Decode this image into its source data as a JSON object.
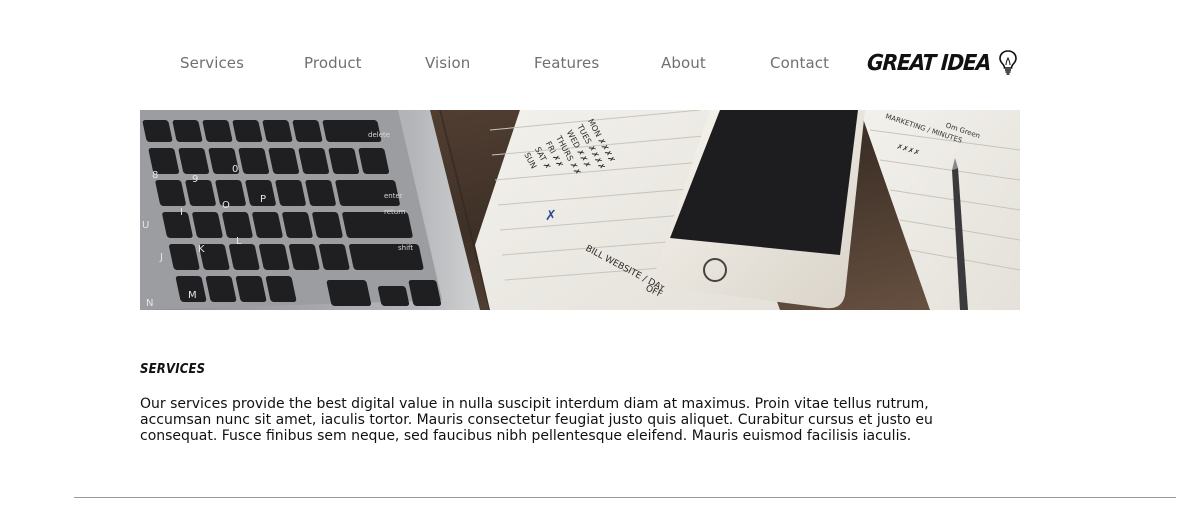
{
  "nav": {
    "items": [
      {
        "label": "Services"
      },
      {
        "label": "Product"
      },
      {
        "label": "Vision"
      },
      {
        "label": "Features"
      },
      {
        "label": "About"
      },
      {
        "label": "Contact"
      }
    ]
  },
  "logo": {
    "text": "GREAT IDEA",
    "icon": "lightbulb-icon"
  },
  "hero": {
    "image": "laptop-keyboard-phone-notebook-photo",
    "notebook_lines": [
      "Bill website",
      "Day",
      "Off",
      "MON",
      "TUES",
      "WED",
      "THURS",
      "FRI",
      "SAT",
      "SUN"
    ],
    "keyboard_keys": {
      "delete": "delete",
      "enter": "enter",
      "return": "return",
      "shift": "shift"
    }
  },
  "services": {
    "title": "SERVICES",
    "body": "Our services provide the best digital value in nulla suscipit interdum diam at maximus. Proin vitae tellus rutrum, accumsan nunc sit amet, iaculis tortor. Mauris consectetur feugiat justo quis aliquet. Curabitur cursus et justo eu consequat. Fusce finibus sem neque, sed faucibus nibh pellentesque eleifend. Mauris euismod facilisis iaculis."
  },
  "colors": {
    "nav_text": "#707070",
    "body_text": "#111111",
    "divider": "#9a9a9a",
    "background": "#ffffff"
  }
}
